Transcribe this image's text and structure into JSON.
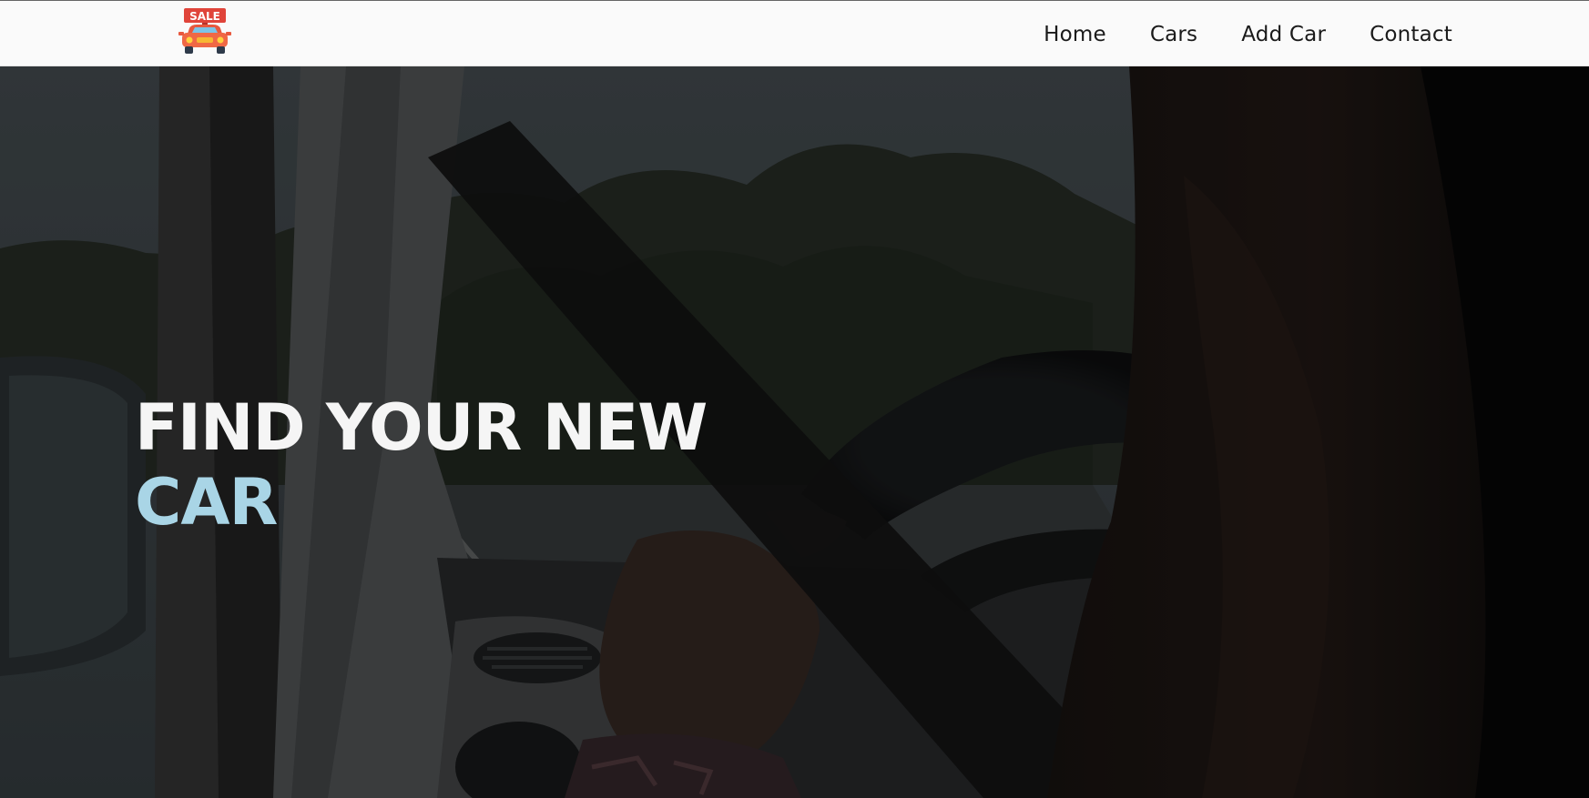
{
  "header": {
    "logo_text": "SALE",
    "nav": [
      {
        "label": "Home"
      },
      {
        "label": "Cars"
      },
      {
        "label": "Add Car"
      },
      {
        "label": "Contact"
      }
    ]
  },
  "hero": {
    "title_line1": "FIND YOUR NEW",
    "title_line2": "CAR",
    "accent_color": "#a9d5e6"
  },
  "icons": {
    "logo": "car-sale-icon"
  }
}
